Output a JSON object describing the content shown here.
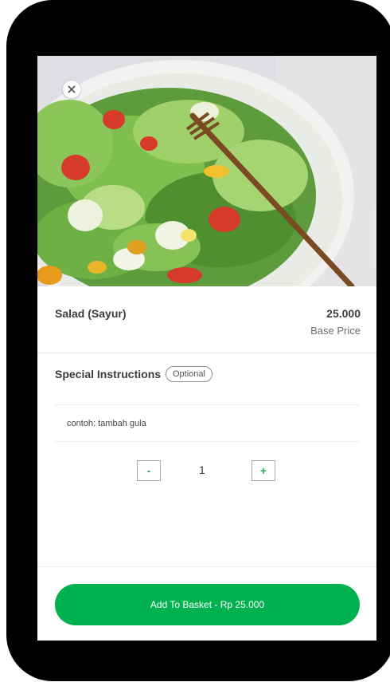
{
  "item": {
    "name": "Salad (Sayur)",
    "price": "25.000",
    "price_caption": "Base Price",
    "image_icon": "salad-photo"
  },
  "instructions": {
    "title": "Special Instructions",
    "optional_label": "Optional",
    "placeholder": "contoh: tambah gula",
    "value": ""
  },
  "quantity": {
    "minus_label": "-",
    "value": "1",
    "plus_label": "+"
  },
  "footer": {
    "add_button_label": "Add To Basket - Rp 25.000"
  },
  "colors": {
    "accent": "#00b14f",
    "text": "#3b3b3b",
    "muted": "#6c6c6c"
  }
}
